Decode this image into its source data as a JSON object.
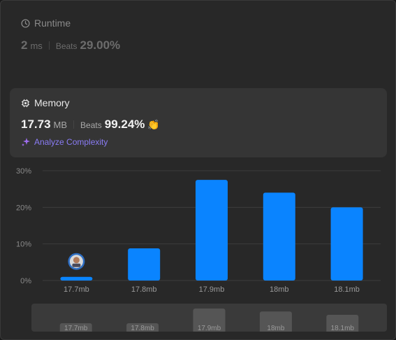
{
  "runtime": {
    "title": "Runtime",
    "value": "2",
    "unit": "ms",
    "beats_label": "Beats",
    "beats_pct": "29.00%"
  },
  "memory": {
    "title": "Memory",
    "value": "17.73",
    "unit": "MB",
    "beats_label": "Beats",
    "beats_pct": "99.24%",
    "analyze_label": "Analyze Complexity"
  },
  "chart_data": {
    "type": "bar",
    "categories": [
      "17.7mb",
      "17.8mb",
      "17.9mb",
      "18mb",
      "18.1mb"
    ],
    "values": [
      1,
      8.8,
      27.5,
      24,
      20
    ],
    "ylim": [
      0,
      30
    ],
    "yticks": [
      "0%",
      "10%",
      "20%",
      "30%"
    ],
    "highlight_index": 0,
    "grid": true
  },
  "colors": {
    "bar": "#0a84ff",
    "mini_bar": "#555555",
    "accent": "#8a7cf5",
    "clap": "#2cbb5d"
  }
}
